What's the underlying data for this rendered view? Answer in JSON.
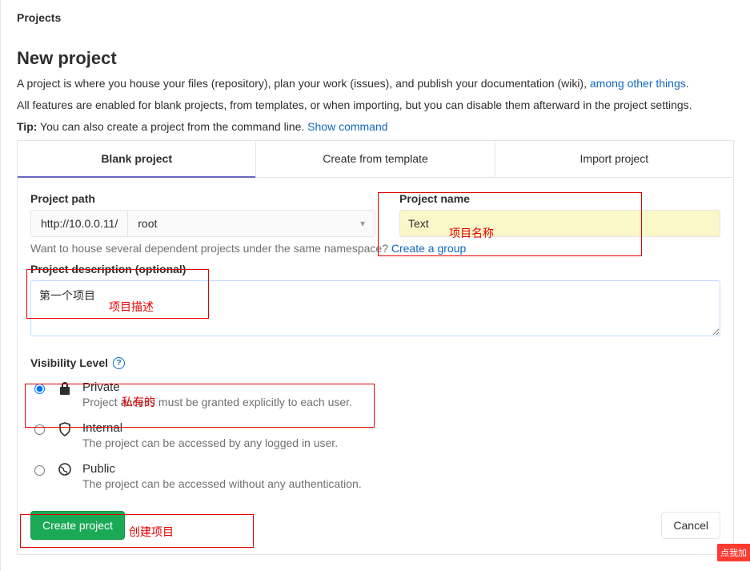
{
  "breadcrumb": "Projects",
  "title": "New project",
  "lead1_prefix": "A project is where you house your files (repository), plan your work (issues), and publish your documentation (wiki), ",
  "lead1_link": "among other things",
  "lead1_suffix": ".",
  "lead2": "All features are enabled for blank projects, from templates, or when importing, but you can disable them afterward in the project settings.",
  "tip_label": "Tip:",
  "tip_text": " You can also create a project from the command line. ",
  "tip_link": "Show command",
  "tabs": {
    "blank": "Blank project",
    "template": "Create from template",
    "import": "Import project"
  },
  "fields": {
    "path_label": "Project path",
    "path_prefix": "http://10.0.0.11/",
    "path_namespace": "root",
    "helper_text": "Want to house several dependent projects under the same namespace? ",
    "helper_link": "Create a group",
    "name_label": "Project name",
    "name_value": "Text",
    "desc_label": "Project description (optional)",
    "desc_value": "第一个项目"
  },
  "visibility": {
    "label": "Visibility Level",
    "options": [
      {
        "key": "private",
        "title": "Private",
        "desc": "Project access must be granted explicitly to each user.",
        "checked": true
      },
      {
        "key": "internal",
        "title": "Internal",
        "desc": "The project can be accessed by any logged in user.",
        "checked": false
      },
      {
        "key": "public",
        "title": "Public",
        "desc": "The project can be accessed without any authentication.",
        "checked": false
      }
    ]
  },
  "buttons": {
    "create": "Create project",
    "cancel": "Cancel"
  },
  "annotations": {
    "name": "项目名称",
    "desc": "项目描述",
    "private": "私有的",
    "create": "创建项目"
  },
  "corner_badge": "点我加"
}
